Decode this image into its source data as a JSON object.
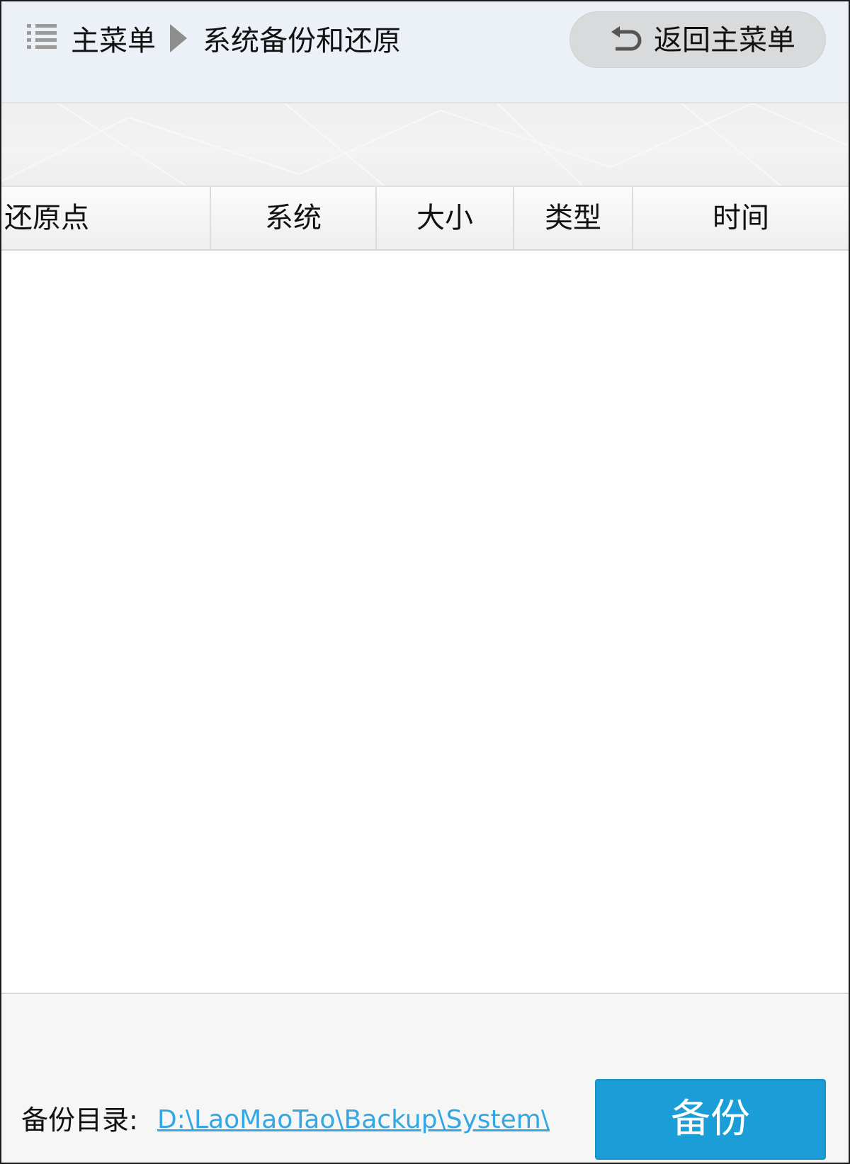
{
  "breadcrumb": {
    "home": "主菜单",
    "current": "系统备份和还原"
  },
  "header": {
    "back_button_label": "返回主菜单"
  },
  "table": {
    "columns": [
      "还原点",
      "系统",
      "大小",
      "类型",
      "时间"
    ],
    "rows": []
  },
  "footer": {
    "directory_label": "备份目录:",
    "directory_path": "D:\\LaoMaoTao\\Backup\\System\\",
    "backup_button_label": "备份"
  },
  "colors": {
    "accent": "#1b9ed8",
    "link": "#34a7e3",
    "header_bg": "#ecf1f8"
  },
  "icons": {
    "menu": "list-menu-icon",
    "breadcrumb_separator": "triangle-right-icon",
    "back": "undo-arrow-icon"
  }
}
